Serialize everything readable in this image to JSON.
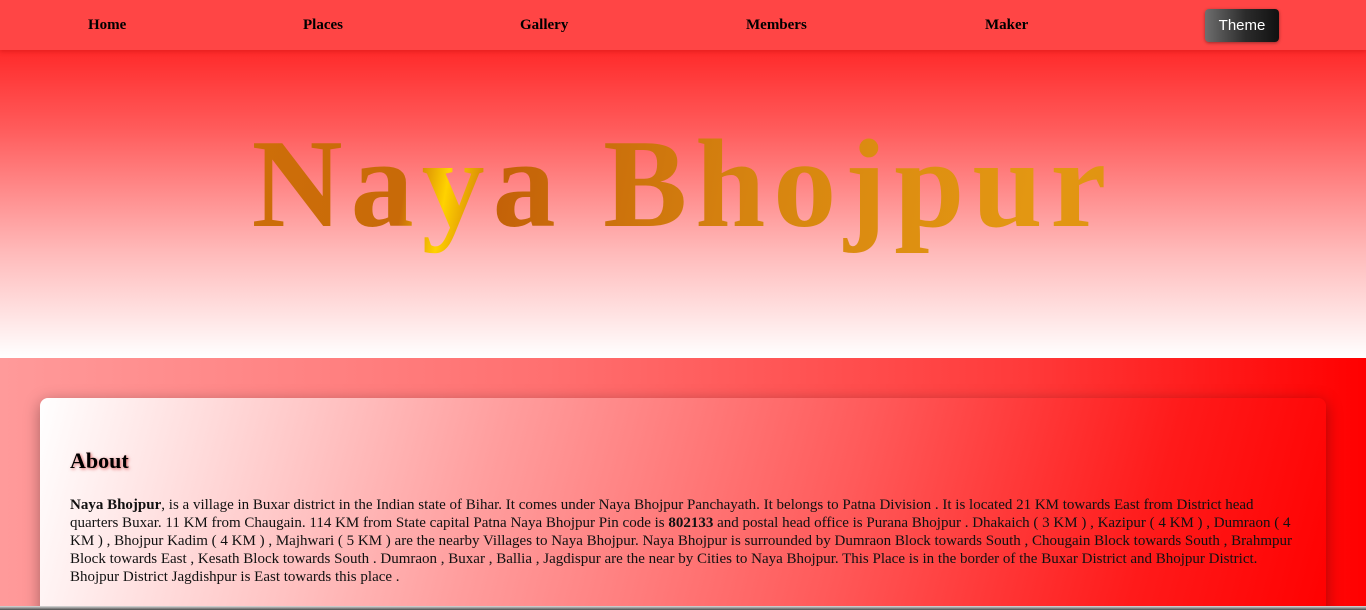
{
  "nav": {
    "home": "Home",
    "places": "Places",
    "gallery": "Gallery",
    "members": "Members",
    "maker": "Maker",
    "theme": "Theme"
  },
  "hero": {
    "title": "Naya Bhojpur"
  },
  "about": {
    "heading": "About",
    "name": "Naya Bhojpur",
    "text_1": ", is a village in Buxar district in the Indian state of Bihar. It comes under Naya Bhojpur Panchayath. It belongs to Patna Division . It is located 21 KM towards East from District head quarters Buxar. 11 KM from Chaugain. 114 KM from State capital Patna Naya Bhojpur Pin code is ",
    "pincode": "802133",
    "text_2": " and postal head office is Purana Bhojpur . Dhakaich ( 3 KM ) , Kazipur ( 4 KM ) , Dumraon ( 4 KM ) , Bhojpur Kadim ( 4 KM ) , Majhwari ( 5 KM ) are the nearby Villages to Naya Bhojpur. Naya Bhojpur is surrounded by Dumraon Block towards South , Chougain Block towards South , Brahmpur Block towards East , Kesath Block towards South . Dumraon , Buxar , Ballia , Jagdispur are the near by Cities to Naya Bhojpur. This Place is in the border of the Buxar District and Bhojpur District. Bhojpur District Jagdishpur is East towards this place ."
  },
  "colors": {
    "nav_bg": "#ff4545",
    "accent_red": "#ff0000",
    "title_gold": "#d68410"
  }
}
